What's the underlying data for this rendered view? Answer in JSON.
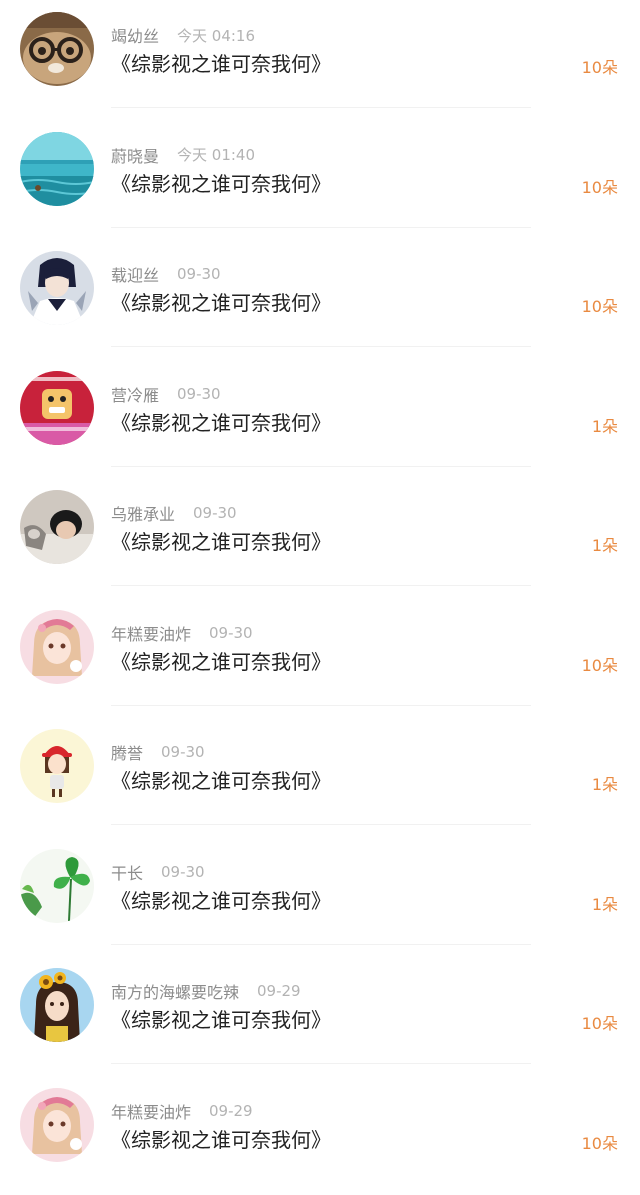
{
  "gifts": [
    {
      "user": "竭幼丝",
      "time": "今天 04:16",
      "book": "《综影视之谁可奈我何》",
      "amount": "10朵",
      "avatar": "bear-glasses-avatar"
    },
    {
      "user": "蔚晓曼",
      "time": "今天 01:40",
      "book": "《综影视之谁可奈我何》",
      "amount": "10朵",
      "avatar": "sea-avatar"
    },
    {
      "user": "载迎丝",
      "time": "09-30",
      "book": "《综影视之谁可奈我何》",
      "amount": "10朵",
      "avatar": "anime-boy-avatar"
    },
    {
      "user": "营冷雁",
      "time": "09-30",
      "book": "《综影视之谁可奈我何》",
      "amount": "1朵",
      "avatar": "cartoon-character-avatar"
    },
    {
      "user": "乌雅承业",
      "time": "09-30",
      "book": "《综影视之谁可奈我何》",
      "amount": "1朵",
      "avatar": "sleeping-person-avatar"
    },
    {
      "user": "年糕要油炸",
      "time": "09-30",
      "book": "《综影视之谁可奈我何》",
      "amount": "10朵",
      "avatar": "pink-girl-avatar"
    },
    {
      "user": "腾誉",
      "time": "09-30",
      "book": "《综影视之谁可奈我何》",
      "amount": "1朵",
      "avatar": "red-hat-girl-avatar"
    },
    {
      "user": "干长",
      "time": "09-30",
      "book": "《综影视之谁可奈我何》",
      "amount": "1朵",
      "avatar": "clover-avatar"
    },
    {
      "user": "南方的海螺要吃辣",
      "time": "09-29",
      "book": "《综影视之谁可奈我何》",
      "amount": "10朵",
      "avatar": "sunflower-girl-avatar"
    },
    {
      "user": "年糕要油炸",
      "time": "09-29",
      "book": "《综影视之谁可奈我何》",
      "amount": "10朵",
      "avatar": "pink-girl-avatar"
    }
  ]
}
